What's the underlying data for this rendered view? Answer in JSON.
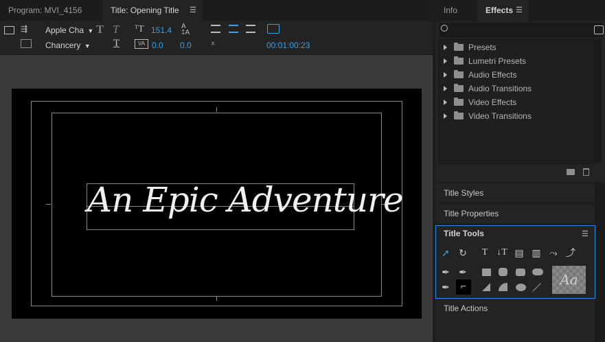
{
  "left_tabs": [
    "Program: MVI_4156",
    "Title: Opening Title"
  ],
  "toolbar": {
    "font_family": "Apple Cha",
    "font_style": "Chancery",
    "font_size": "151.4",
    "kerning": "0.0",
    "tracking": "0.0",
    "timecode": "00:01:00:23"
  },
  "canvas": {
    "title_text": "An Epic Adventure"
  },
  "right_tabs": [
    "Info",
    "Effects"
  ],
  "effects_items": [
    "Presets",
    "Lumetri Presets",
    "Audio Effects",
    "Audio Transitions",
    "Video Effects",
    "Video Transitions"
  ],
  "sections": {
    "title_styles": "Title Styles",
    "title_properties": "Title Properties",
    "title_tools": "Title Tools",
    "title_actions": "Title Actions"
  },
  "tool_preview_text": "Aa",
  "colors": {
    "accent": "#2d8ceb",
    "value_blue": "#3aa0e8",
    "canvas_bg": "#000000",
    "panel_bg": "#232323"
  }
}
